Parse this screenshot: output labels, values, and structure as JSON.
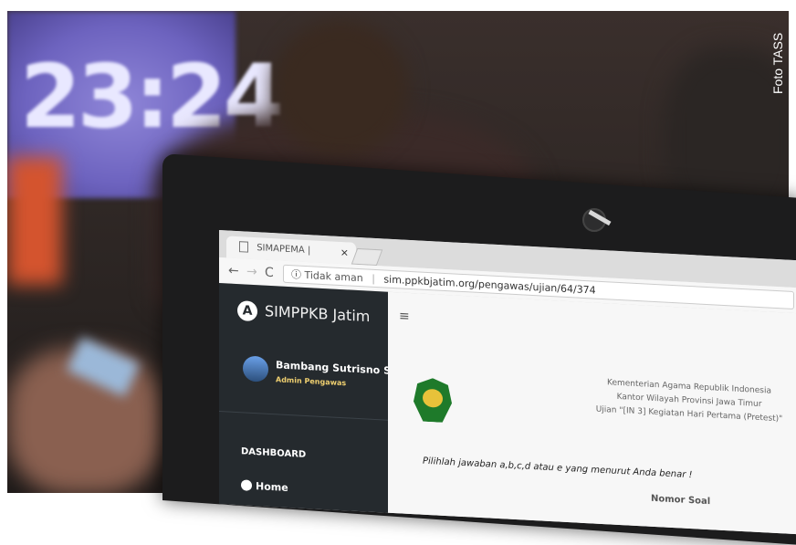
{
  "background": {
    "projected_clock": "23:24"
  },
  "watermark": "Foto TASS",
  "browser": {
    "tab_title": "SIMAPEMA | KEMENAG",
    "tab_close": "×",
    "security_label": "Tidak aman",
    "url": "sim.ppkbjatim.org/pengawas/ujian/64/374"
  },
  "sidebar": {
    "brand": "SIMPPKB Jatim",
    "user_name": "Bambang Sutrisno Spd.MM",
    "user_role": "Admin Pengawas",
    "section": "DASHBOARD",
    "home": "Home"
  },
  "main": {
    "menu_icon": "≡",
    "header_line1": "Kementerian Agama Republik Indonesia",
    "header_line2": "Kantor Wilayah Provinsi Jawa Timur",
    "header_line3": "Ujian \"[IN 3] Kegiatan Hari Pertama (Pretest)\"",
    "instruction": "Pilihlah jawaban a,b,c,d atau e yang menurut Anda benar !",
    "question_number_label": "Nomor Soal"
  }
}
